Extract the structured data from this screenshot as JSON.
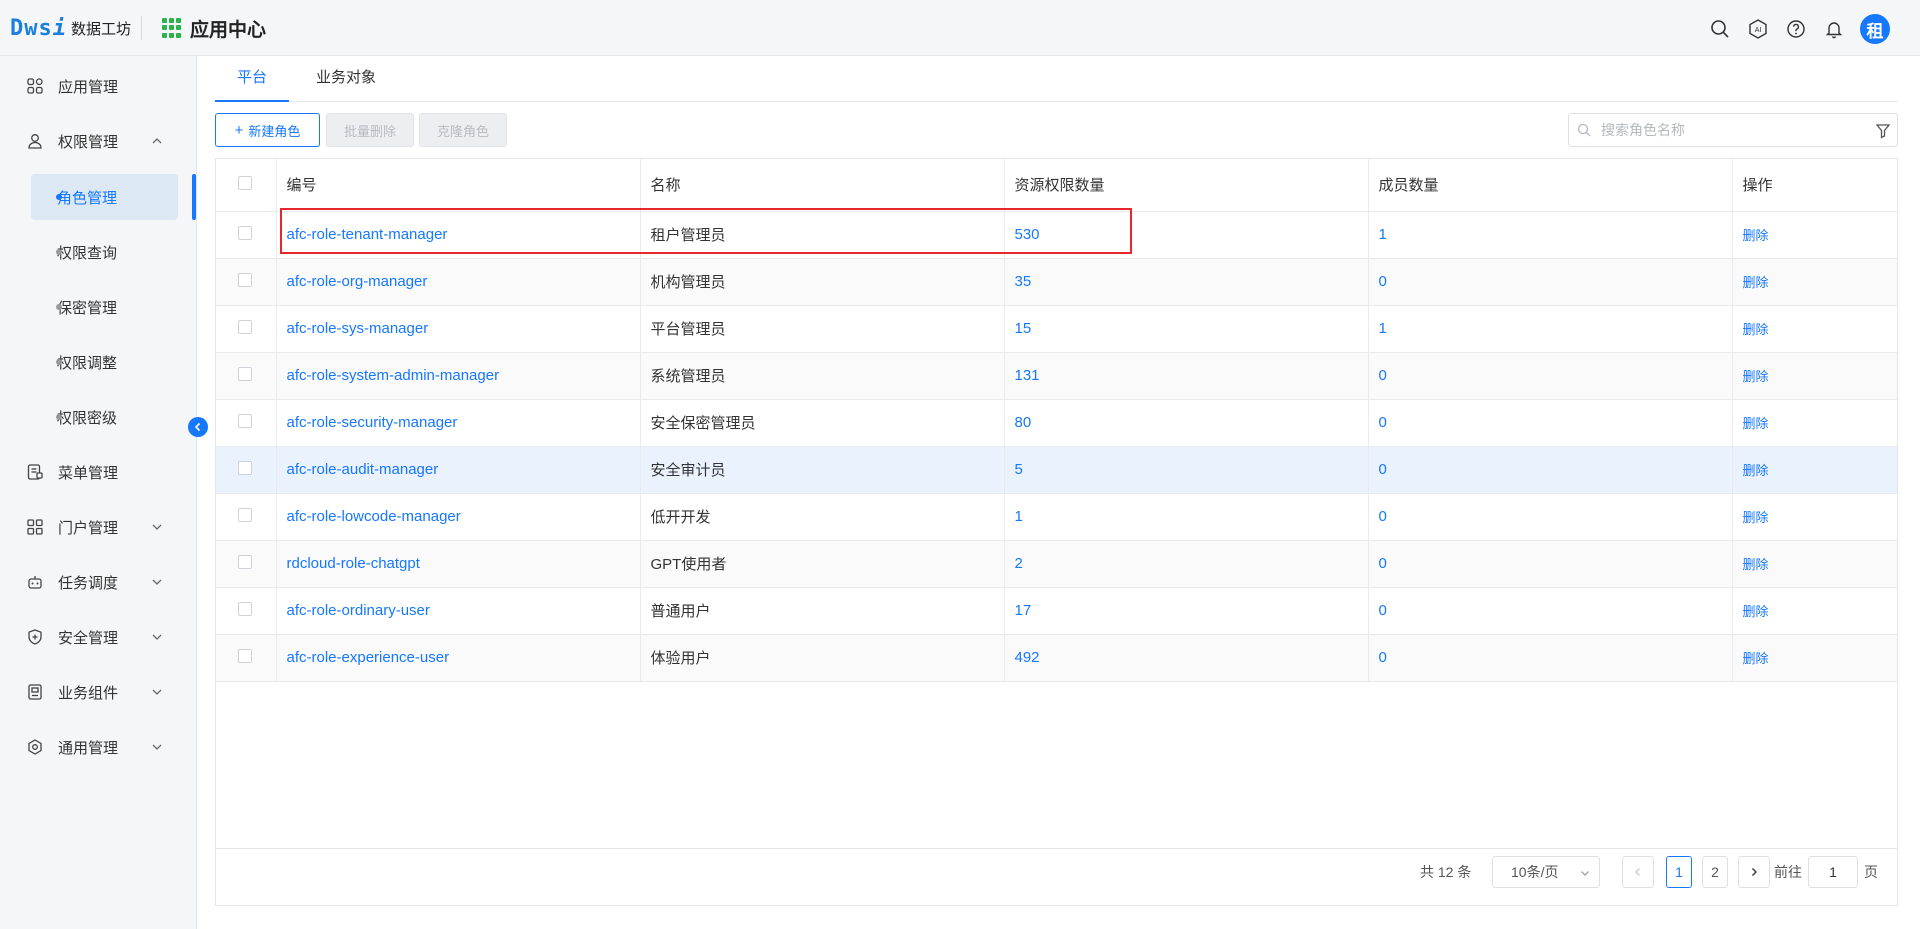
{
  "header": {
    "logo_mark": "Dws",
    "logo_mark_i": "i",
    "logo_text": "数据工坊",
    "app_center": "应用中心",
    "avatar_text": "租",
    "icons": [
      "search-icon",
      "ai-icon",
      "help-icon",
      "bell-icon"
    ]
  },
  "sidebar": {
    "items": [
      {
        "label": "应用管理",
        "icon": "apps-icon"
      },
      {
        "label": "权限管理",
        "icon": "user-icon",
        "expanded": true
      },
      {
        "label": "菜单管理",
        "icon": "menu-doc-icon"
      },
      {
        "label": "门户管理",
        "icon": "portal-icon"
      },
      {
        "label": "任务调度",
        "icon": "robot-icon"
      },
      {
        "label": "安全管理",
        "icon": "shield-icon"
      },
      {
        "label": "业务组件",
        "icon": "component-icon"
      },
      {
        "label": "通用管理",
        "icon": "settings-icon"
      }
    ],
    "sub_items": [
      "角色管理",
      "权限查询",
      "保密管理",
      "权限调整",
      "权限密级"
    ],
    "active_sub": "角色管理"
  },
  "tabs": [
    "平台",
    "业务对象"
  ],
  "active_tab": "平台",
  "toolbar": {
    "new_role": "新建角色",
    "batch_delete": "批量删除",
    "clone_role": "克隆角色",
    "search_placeholder": "搜索角色名称"
  },
  "table": {
    "columns": [
      "编号",
      "名称",
      "资源权限数量",
      "成员数量",
      "操作"
    ],
    "rows": [
      {
        "code": "afc-role-tenant-manager",
        "name": "租户管理员",
        "resources": "530",
        "members": "1",
        "action": "删除"
      },
      {
        "code": "afc-role-org-manager",
        "name": "机构管理员",
        "resources": "35",
        "members": "0",
        "action": "删除"
      },
      {
        "code": "afc-role-sys-manager",
        "name": "平台管理员",
        "resources": "15",
        "members": "1",
        "action": "删除"
      },
      {
        "code": "afc-role-system-admin-manager",
        "name": "系统管理员",
        "resources": "131",
        "members": "0",
        "action": "删除"
      },
      {
        "code": "afc-role-security-manager",
        "name": "安全保密管理员",
        "resources": "80",
        "members": "0",
        "action": "删除"
      },
      {
        "code": "afc-role-audit-manager",
        "name": "安全审计员",
        "resources": "5",
        "members": "0",
        "action": "删除"
      },
      {
        "code": "afc-role-lowcode-manager",
        "name": "低开开发",
        "resources": "1",
        "members": "0",
        "action": "删除"
      },
      {
        "code": "rdcloud-role-chatgpt",
        "name": "GPT使用者",
        "resources": "2",
        "members": "0",
        "action": "删除"
      },
      {
        "code": "afc-role-ordinary-user",
        "name": "普通用户",
        "resources": "17",
        "members": "0",
        "action": "删除"
      },
      {
        "code": "afc-role-experience-user",
        "name": "体验用户",
        "resources": "492",
        "members": "0",
        "action": "删除"
      }
    ]
  },
  "pagination": {
    "total": "共 12 条",
    "page_size": "10条/页",
    "pages": [
      "1",
      "2"
    ],
    "current": "1",
    "goto_label": "前往",
    "goto_value": "1",
    "page_suffix": "页"
  },
  "colors": {
    "accent": "#1677ff",
    "highlight_box": "#e8262d",
    "brand_green": "#2db24a"
  }
}
